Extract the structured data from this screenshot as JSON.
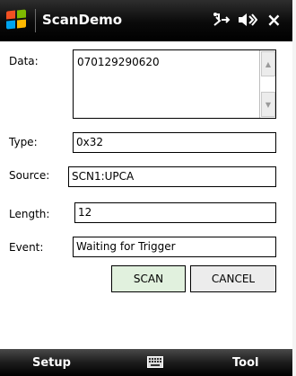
{
  "title_bar": {
    "app_title": "ScanDemo",
    "close_glyph": "×",
    "icons": [
      "windows-start-icon",
      "connectivity-icon",
      "speaker-icon",
      "close-icon"
    ]
  },
  "form": {
    "data_label": "Data:",
    "data_value": "070129290620",
    "type_label": "Type:",
    "type_value": "0x32",
    "source_label": "Source:",
    "source_value": "SCN1:UPCA",
    "length_label": "Length:",
    "length_value": "12",
    "event_label": "Event:",
    "event_value": "Waiting for Trigger"
  },
  "buttons": {
    "scan_label": "SCAN",
    "cancel_label": "CANCEL"
  },
  "menu_bar": {
    "left_softkey": "Setup",
    "right_softkey": "Tool"
  },
  "colors": {
    "titlebar": "#000000",
    "scan_button_bg": "#e1f1de",
    "cancel_button_bg": "#ececec",
    "windows_logo": [
      "#f25022",
      "#7fba00",
      "#00a4ef",
      "#ffb900"
    ]
  }
}
